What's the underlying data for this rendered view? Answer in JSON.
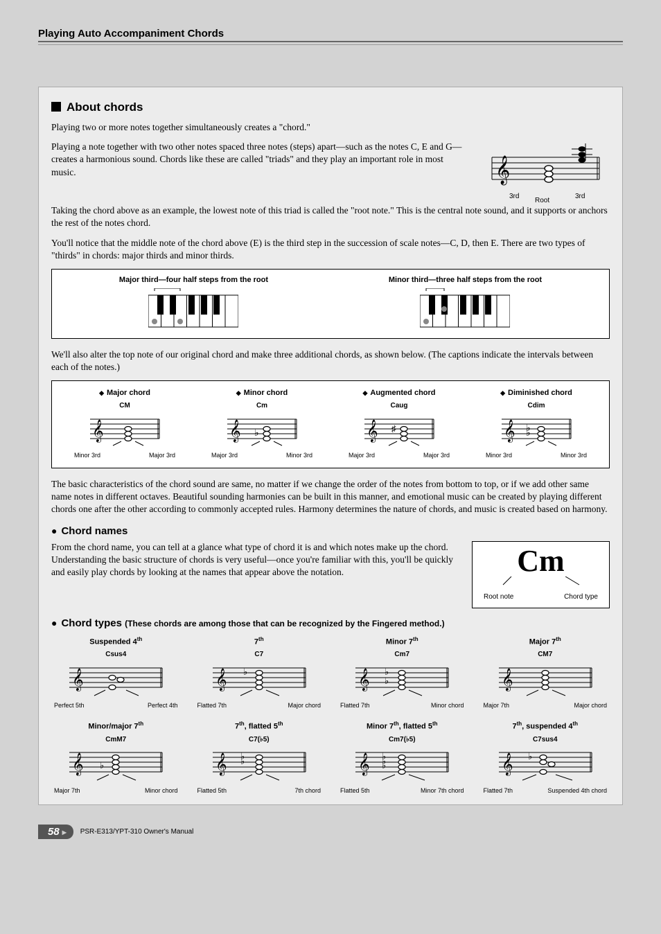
{
  "header": "Playing Auto Accompaniment Chords",
  "about": {
    "title": "About chords",
    "p1": "Playing two or more notes together simultaneously creates a \"chord.\"",
    "p2": "Playing a note together with two other notes spaced three notes (steps) apart—such as the notes C, E and G—creates a harmonious sound. Chords like these are called \"triads\" and they play an important role in most music.",
    "root_labels": {
      "left3rd": "3rd",
      "root": "Root",
      "right3rd": "3rd"
    },
    "p3": "Taking the chord above as an example, the lowest note of this triad is called the \"root note.\" This is the central note sound, and it supports or anchors the rest of the notes chord.",
    "p4": "You'll notice that the middle note of the chord above (E) is the third step in the succession of scale notes—C, D, then E. There are two types of \"thirds\" in chords: major thirds and minor thirds.",
    "major_third": "Major third—four half steps from the root",
    "minor_third": "Minor third—three half steps from the root",
    "p5": "We'll also alter the top note of our original chord and make three additional chords, as shown below. (The captions indicate the intervals between each of the notes.)",
    "chords": [
      {
        "title": "Major chord",
        "sym": "CM",
        "l": "Minor 3rd",
        "r": "Major 3rd"
      },
      {
        "title": "Minor chord",
        "sym": "Cm",
        "l": "Major 3rd",
        "r": "Minor 3rd"
      },
      {
        "title": "Augmented chord",
        "sym": "Caug",
        "l": "Major 3rd",
        "r": "Major 3rd"
      },
      {
        "title": "Diminished chord",
        "sym": "Cdim",
        "l": "Minor 3rd",
        "r": "Minor 3rd"
      }
    ],
    "p6": "The basic characteristics of the chord sound are same, no matter if we change the order of the notes from bottom to top, or if we add other same name notes in different octaves. Beautiful sounding harmonies can be built in this manner, and emotional music can be created by playing different chords one after the other according to commonly accepted rules. Harmony determines the nature of chords, and music is created based on harmony."
  },
  "names": {
    "title": "Chord names",
    "p": "From the chord name, you can tell at a glance what type of chord it is and which notes make up the chord. Understanding the basic structure of chords is very useful—once you're familiar with this, you'll be quickly and easily play chords by looking at the names that appear above the notation.",
    "big": "Cm",
    "root": "Root note",
    "type": "Chord type"
  },
  "types": {
    "title": "Chord types",
    "note": "(These chords are among those that can be recognized by the Fingered method.)",
    "grid": [
      {
        "title": "Suspended 4",
        "th": "th",
        "sym": "Csus4",
        "l": "Perfect 5th",
        "r": "Perfect 4th"
      },
      {
        "title": "7",
        "th": "th",
        "sym": "C7",
        "l": "Flatted 7th",
        "r": "Major chord"
      },
      {
        "title": "Minor 7",
        "th": "th",
        "sym": "Cm7",
        "l": "Flatted 7th",
        "r": "Minor chord"
      },
      {
        "title": "Major 7",
        "th": "th",
        "sym": "CM7",
        "l": "Major 7th",
        "r": "Major chord"
      },
      {
        "title": "Minor/major 7",
        "th": "th",
        "sym": "CmM7",
        "l": "Major 7th",
        "r": "Minor chord"
      },
      {
        "title": "7",
        "th": "th",
        "title_suffix": ", flatted 5",
        "th2": "th",
        "sym": "C7(♭5)",
        "l": "Flatted 5th",
        "r": "7th chord"
      },
      {
        "title": "Minor 7",
        "th": "th",
        "title_suffix": ", flatted 5",
        "th2": "th",
        "sym": "Cm7(♭5)",
        "l": "Flatted 5th",
        "r": "Minor 7th chord"
      },
      {
        "title": "7",
        "th": "th",
        "title_suffix": ", suspended 4",
        "th2": "th",
        "sym": "C7sus4",
        "l": "Flatted 7th",
        "r": "Suspended 4th chord"
      }
    ]
  },
  "footer": {
    "page": "58",
    "manual": "PSR-E313/YPT-310   Owner's Manual"
  }
}
